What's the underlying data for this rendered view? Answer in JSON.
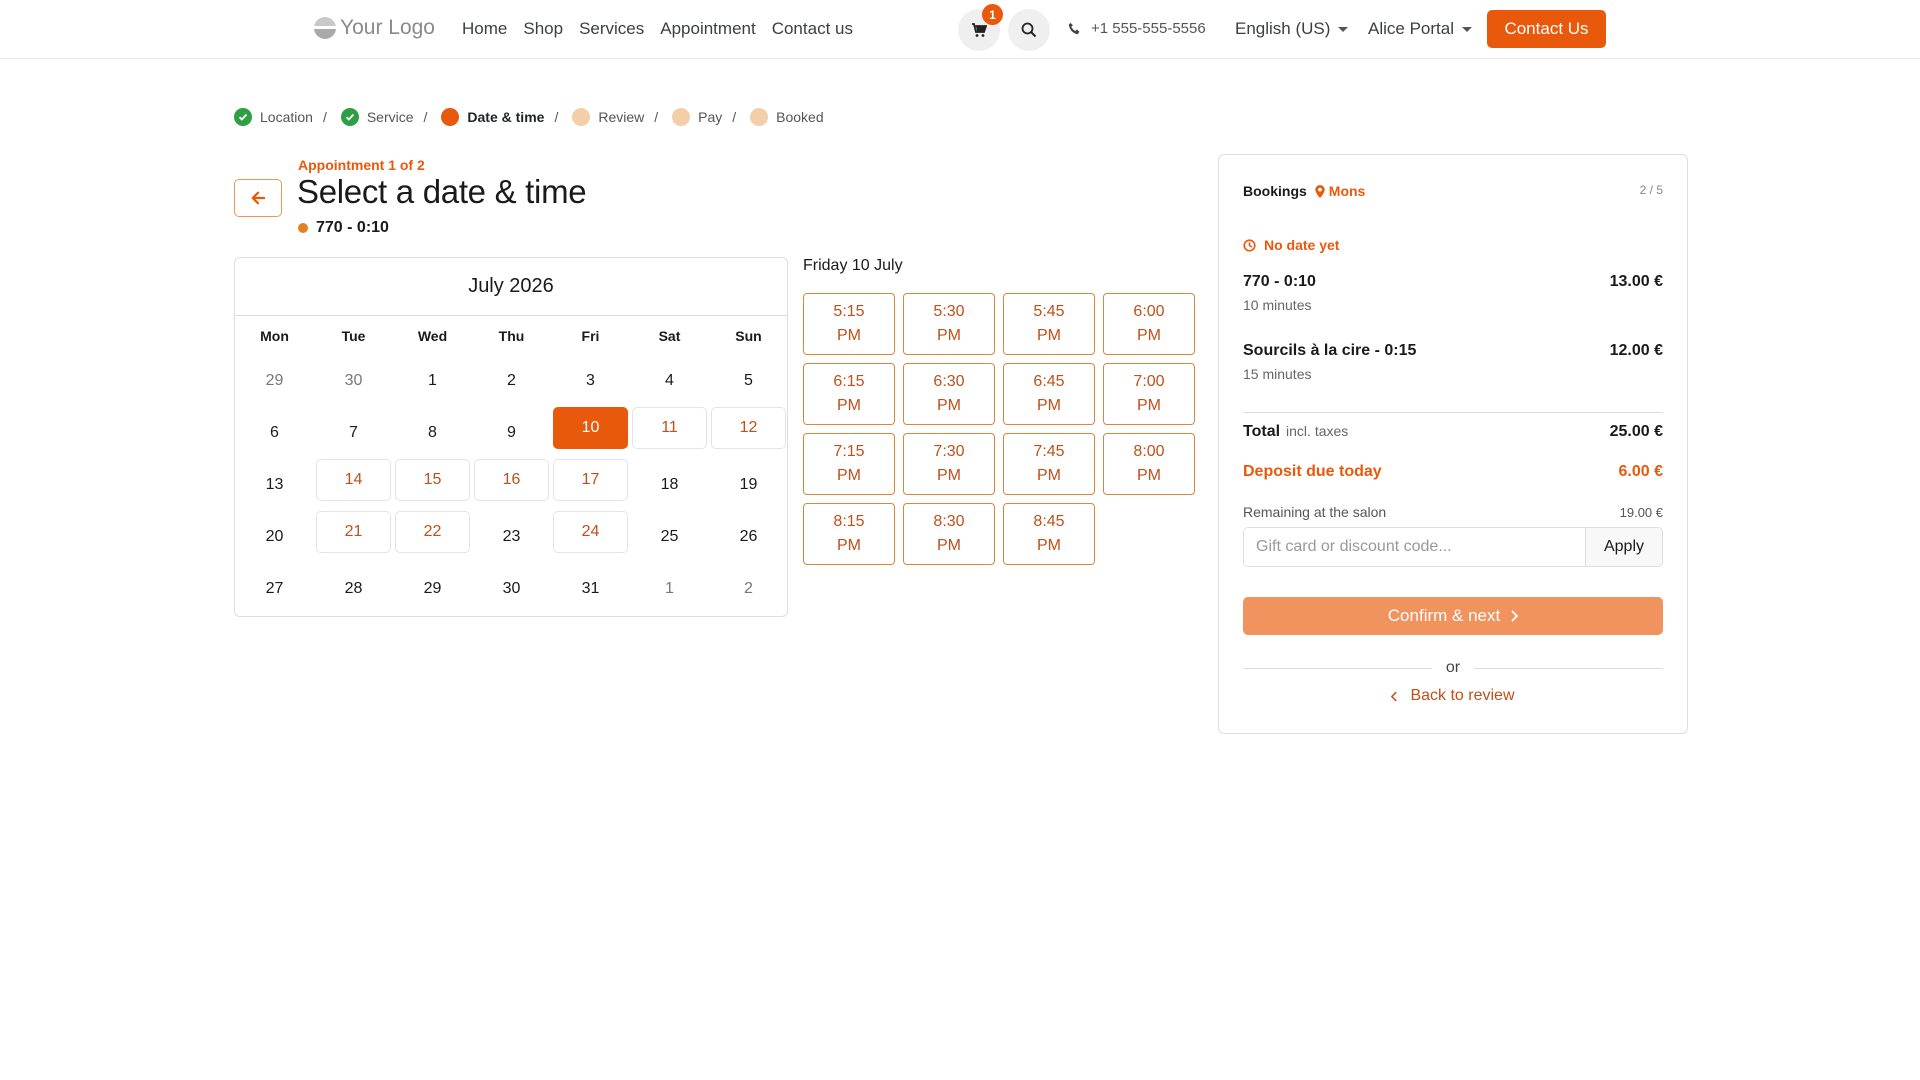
{
  "header": {
    "logo_text": "Your Logo",
    "nav": [
      "Home",
      "Shop",
      "Services",
      "Appointment",
      "Contact us"
    ],
    "cart_count": "1",
    "phone": "+1 555-555-5556",
    "language": "English (US)",
    "user": "Alice Portal",
    "cta_label": "Contact Us",
    "accent_color": "#e8590c"
  },
  "steps": [
    {
      "label": "Location",
      "state": "done"
    },
    {
      "label": "Service",
      "state": "done"
    },
    {
      "label": "Date & time",
      "state": "current"
    },
    {
      "label": "Review",
      "state": "todo"
    },
    {
      "label": "Pay",
      "state": "todo"
    },
    {
      "label": "Booked",
      "state": "todo"
    }
  ],
  "main": {
    "appointment_label": "Appointment 1 of 2",
    "title": "Select a date & time",
    "service_name": "770 - 0:10"
  },
  "calendar": {
    "month_label": "July 2026",
    "weekdays": [
      "Mon",
      "Tue",
      "Wed",
      "Thu",
      "Fri",
      "Sat",
      "Sun"
    ],
    "days": [
      {
        "d": "29",
        "s": "out"
      },
      {
        "d": "30",
        "s": "out"
      },
      {
        "d": "1",
        "s": ""
      },
      {
        "d": "2",
        "s": ""
      },
      {
        "d": "3",
        "s": ""
      },
      {
        "d": "4",
        "s": ""
      },
      {
        "d": "5",
        "s": ""
      },
      {
        "d": "6",
        "s": ""
      },
      {
        "d": "7",
        "s": ""
      },
      {
        "d": "8",
        "s": ""
      },
      {
        "d": "9",
        "s": ""
      },
      {
        "d": "10",
        "s": "sel"
      },
      {
        "d": "11",
        "s": "avail"
      },
      {
        "d": "12",
        "s": "avail"
      },
      {
        "d": "13",
        "s": ""
      },
      {
        "d": "14",
        "s": "avail"
      },
      {
        "d": "15",
        "s": "avail"
      },
      {
        "d": "16",
        "s": "avail"
      },
      {
        "d": "17",
        "s": "avail"
      },
      {
        "d": "18",
        "s": ""
      },
      {
        "d": "19",
        "s": ""
      },
      {
        "d": "20",
        "s": ""
      },
      {
        "d": "21",
        "s": "avail"
      },
      {
        "d": "22",
        "s": "avail"
      },
      {
        "d": "23",
        "s": ""
      },
      {
        "d": "24",
        "s": "avail"
      },
      {
        "d": "25",
        "s": ""
      },
      {
        "d": "26",
        "s": ""
      },
      {
        "d": "27",
        "s": ""
      },
      {
        "d": "28",
        "s": ""
      },
      {
        "d": "29",
        "s": ""
      },
      {
        "d": "30",
        "s": ""
      },
      {
        "d": "31",
        "s": ""
      },
      {
        "d": "1",
        "s": "out"
      },
      {
        "d": "2",
        "s": "out"
      }
    ]
  },
  "slots": {
    "date_label": "Friday 10 July",
    "times": [
      "5:15\nPM",
      "5:30\nPM",
      "5:45\nPM",
      "6:00\nPM",
      "6:15\nPM",
      "6:30\nPM",
      "6:45\nPM",
      "7:00\nPM",
      "7:15\nPM",
      "7:30\nPM",
      "7:45\nPM",
      "8:00\nPM",
      "8:15\nPM",
      "8:30\nPM",
      "8:45\nPM"
    ]
  },
  "bookings": {
    "title": "Bookings",
    "location": "Mons",
    "count": "2 / 5",
    "no_date": "No date yet",
    "items": [
      {
        "name": "770 - 0:10",
        "duration": "10 minutes",
        "price": "13.00 €"
      },
      {
        "name": "Sourcils à la cire - 0:15",
        "duration": "15 minutes",
        "price": "12.00 €"
      }
    ],
    "total_label": "Total",
    "total_note": "incl. taxes",
    "total": "25.00 €",
    "deposit_label": "Deposit due today",
    "deposit": "6.00 €",
    "remaining_label": "Remaining at the salon",
    "remaining": "19.00 €",
    "discount_placeholder": "Gift card or discount code...",
    "apply_label": "Apply",
    "confirm_label": "Confirm & next",
    "or_label": "or",
    "back_label": "Back to review"
  }
}
